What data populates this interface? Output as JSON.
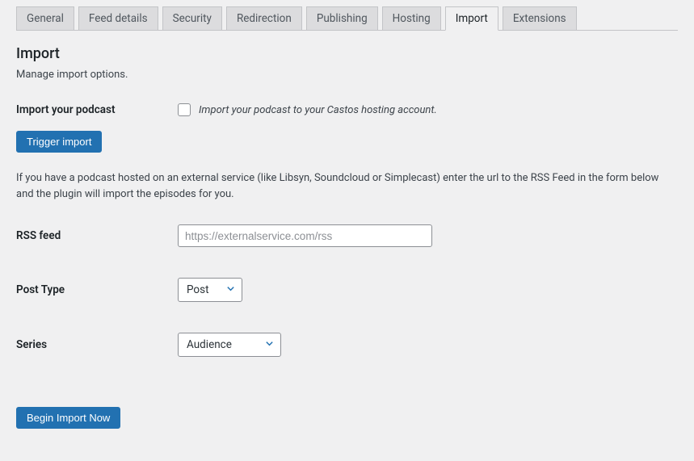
{
  "tabs": {
    "items": [
      {
        "label": "General"
      },
      {
        "label": "Feed details"
      },
      {
        "label": "Security"
      },
      {
        "label": "Redirection"
      },
      {
        "label": "Publishing"
      },
      {
        "label": "Hosting"
      },
      {
        "label": "Import"
      },
      {
        "label": "Extensions"
      }
    ],
    "active_index": 6
  },
  "section": {
    "title": "Import",
    "desc": "Manage import options."
  },
  "import_podcast": {
    "label": "Import your podcast",
    "checkbox_label": "Import your podcast to your Castos hosting account."
  },
  "trigger_button": "Trigger import",
  "help_text": "If you have a podcast hosted on an external service (like Libsyn, Soundcloud or Simplecast) enter the url to the RSS Feed in the form below and the plugin will import the episodes for you.",
  "rss": {
    "label": "RSS feed",
    "placeholder": "https://externalservice.com/rss",
    "value": ""
  },
  "post_type": {
    "label": "Post Type",
    "selected": "Post"
  },
  "series": {
    "label": "Series",
    "selected": "Audience"
  },
  "begin_button": "Begin Import Now"
}
